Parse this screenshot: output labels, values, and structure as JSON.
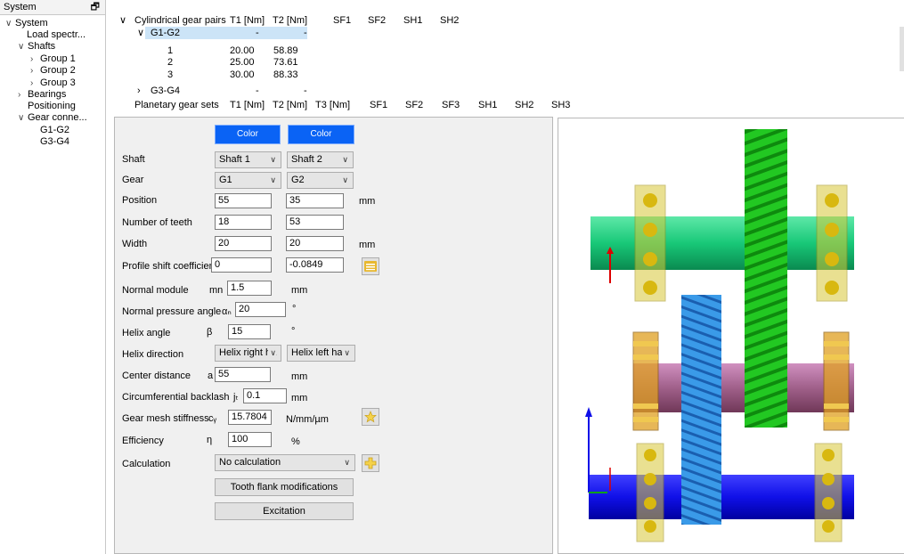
{
  "system_panel": {
    "title": "System",
    "pin_icon": "pin-icon",
    "tree": [
      {
        "label": "System",
        "arrow": "∨"
      },
      {
        "label": "Load spectr...",
        "arrow": ""
      },
      {
        "label": "Shafts",
        "arrow": "∨"
      },
      {
        "label": "Group 1",
        "arrow": "›"
      },
      {
        "label": "Group 2",
        "arrow": "›"
      },
      {
        "label": "Group 3",
        "arrow": "›"
      },
      {
        "label": "Bearings",
        "arrow": "›"
      },
      {
        "label": "Positioning",
        "arrow": ""
      },
      {
        "label": "Gear conne...",
        "arrow": "∨"
      },
      {
        "label": "G1-G2",
        "arrow": ""
      },
      {
        "label": "G3-G4",
        "arrow": ""
      }
    ]
  },
  "pairs_table": {
    "cyl_header": {
      "arrow": "∨",
      "label": "Cylindrical gear pairs",
      "cols": [
        "T1 [Nm]",
        "T2 [Nm]",
        "SF1",
        "SF2",
        "SH1",
        "SH2"
      ]
    },
    "g1g2": {
      "arrow": "∨",
      "label": "G1-G2",
      "t1": "-",
      "t2": "-"
    },
    "rows": [
      {
        "idx": "1",
        "t1": "20.00",
        "t2": "58.89"
      },
      {
        "idx": "2",
        "t1": "25.00",
        "t2": "73.61"
      },
      {
        "idx": "3",
        "t1": "30.00",
        "t2": "88.33"
      }
    ],
    "g3g4": {
      "arrow": "›",
      "label": "G3-G4",
      "t1": "-",
      "t2": "-"
    },
    "planetary_header": {
      "label": "Planetary gear sets",
      "cols": [
        "T1 [Nm]",
        "T2 [Nm]",
        "T3 [Nm]",
        "SF1",
        "SF2",
        "SF3",
        "SH1",
        "SH2",
        "SH3"
      ]
    }
  },
  "properties": {
    "color1": "Color",
    "color2": "Color",
    "shaft_label": "Shaft",
    "shaft1": "Shaft 1",
    "shaft2": "Shaft 2",
    "gear_label": "Gear",
    "gear1": "G1",
    "gear2": "G2",
    "position_label": "Position",
    "position1": "55",
    "position2": "35",
    "position_unit": "mm",
    "teeth_label": "Number of teeth",
    "teeth1": "18",
    "teeth2": "53",
    "width_label": "Width",
    "width1": "20",
    "width2": "20",
    "width_unit": "mm",
    "profile_label": "Profile shift coefficient",
    "profile1": "0",
    "profile2": "-0.0849",
    "module_label": "Normal module",
    "module_sym": "mn",
    "module_val": "1.5",
    "module_unit": "mm",
    "pressure_label": "Normal pressure angle",
    "pressure_sym": "αₙ",
    "pressure_val": "20",
    "pressure_unit": "°",
    "helix_label": "Helix angle",
    "helix_sym": "β",
    "helix_val": "15",
    "helix_unit": "°",
    "helixdir_label": "Helix direction",
    "helixdir1": "Helix right ha",
    "helixdir2": "Helix left har",
    "center_label": "Center distance",
    "center_sym": "a",
    "center_val": "55",
    "center_unit": "mm",
    "backlash_label": "Circumferential backlash",
    "backlash_sym": "jₜ",
    "backlash_val": "0.1",
    "backlash_unit": "mm",
    "stiffness_label": "Gear mesh stiffness",
    "stiffness_sym": "cᵧ",
    "stiffness_val": "15.7804",
    "stiffness_unit": "N/mm/µm",
    "efficiency_label": "Efficiency",
    "efficiency_sym": "η",
    "efficiency_val": "100",
    "efficiency_unit": "%",
    "calc_label": "Calculation",
    "calc_val": "No calculation",
    "tooth_flank_btn": "Tooth flank modifications",
    "excitation_btn": "Excitation"
  },
  "colors": {
    "color_button": "#0a63f5",
    "shaft_green": "#18c878",
    "shaft_mauve": "#a0608a",
    "shaft_blue": "#1010e8",
    "gear_green": "#2ed82e",
    "gear_blue": "#2a8ee0",
    "bearing_yellow": "#d8c838"
  }
}
